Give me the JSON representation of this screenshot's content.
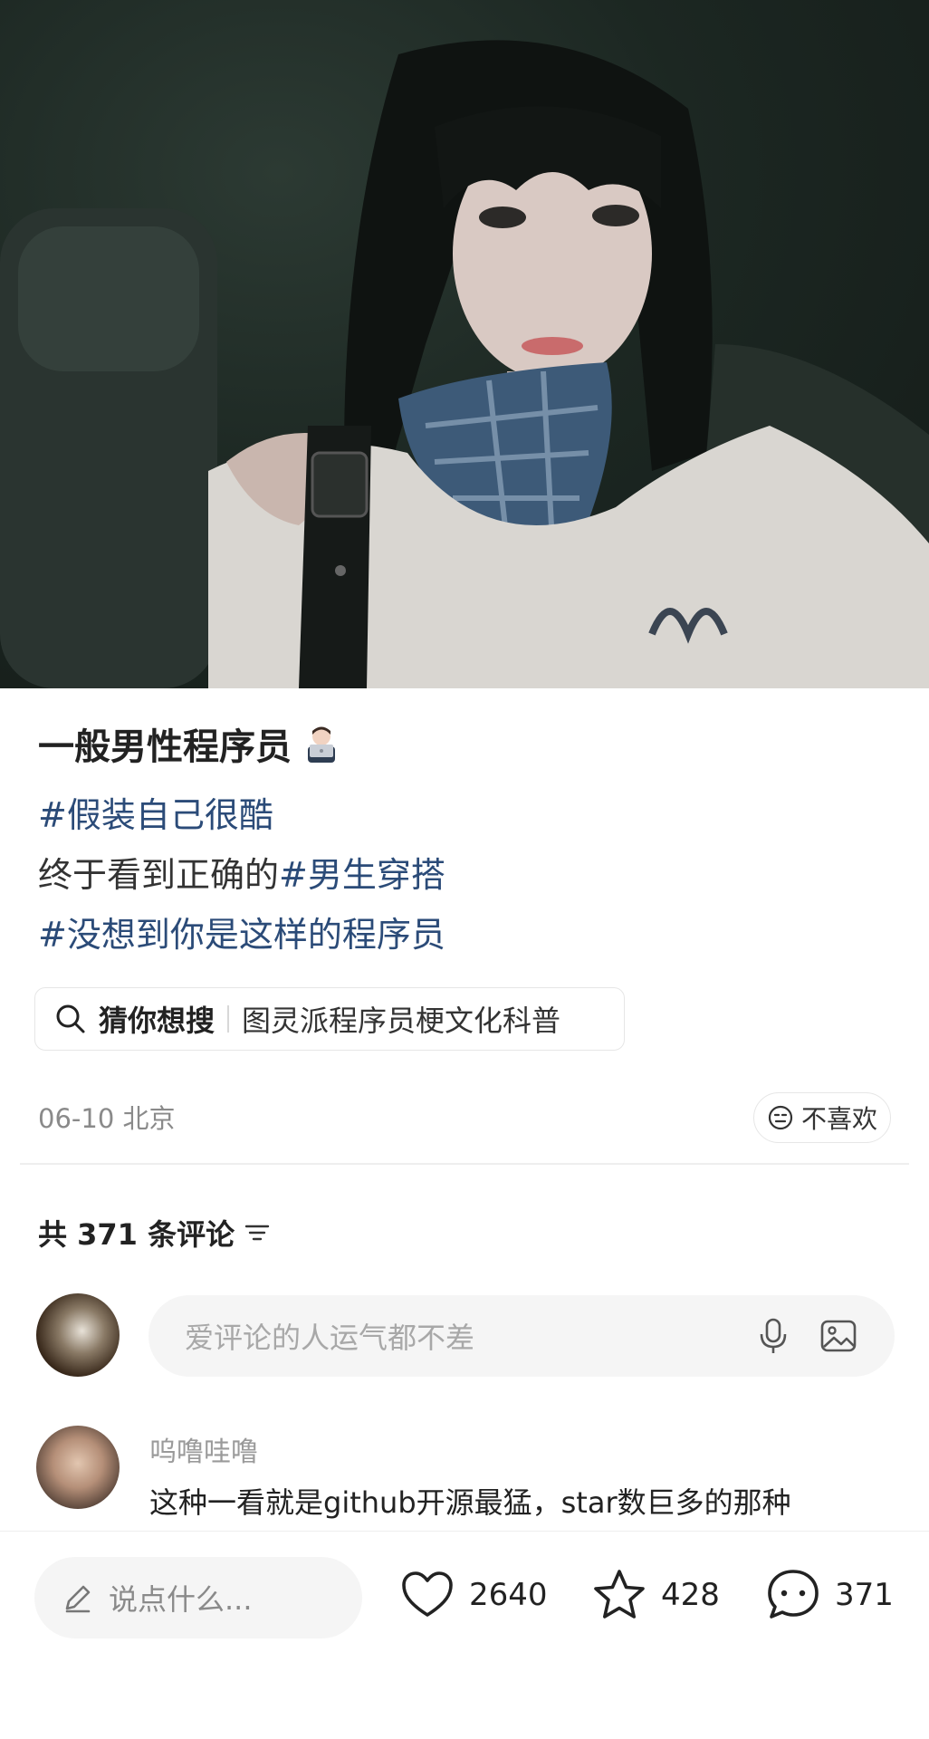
{
  "post": {
    "title": "一般男性程序员",
    "title_emoji": "technologist-emoji",
    "line1_tag": "#假装自己很酷",
    "line2_text": "终于看到正确的",
    "line2_tag": "#男生穿搭",
    "line3_tag": "#没想到你是这样的程序员"
  },
  "suggest": {
    "label": "猜你想搜",
    "query": "图灵派程序员梗文化科普"
  },
  "meta": {
    "date_location": "06-10 北京",
    "dislike": "不喜欢"
  },
  "comments": {
    "count_label": "共 371 条评论",
    "input_placeholder": "爱评论的人运气都不差",
    "first": {
      "user": "呜噜哇噜",
      "text": "这种一看就是github开源最猛，star数巨多的那种"
    }
  },
  "bottom": {
    "say_placeholder": "说点什么...",
    "likes": "2640",
    "favorites": "428",
    "comments": "371"
  },
  "colors": {
    "tag": "#2b4b78",
    "muted": "#8a8a8a",
    "input_bg": "#f5f5f5"
  }
}
